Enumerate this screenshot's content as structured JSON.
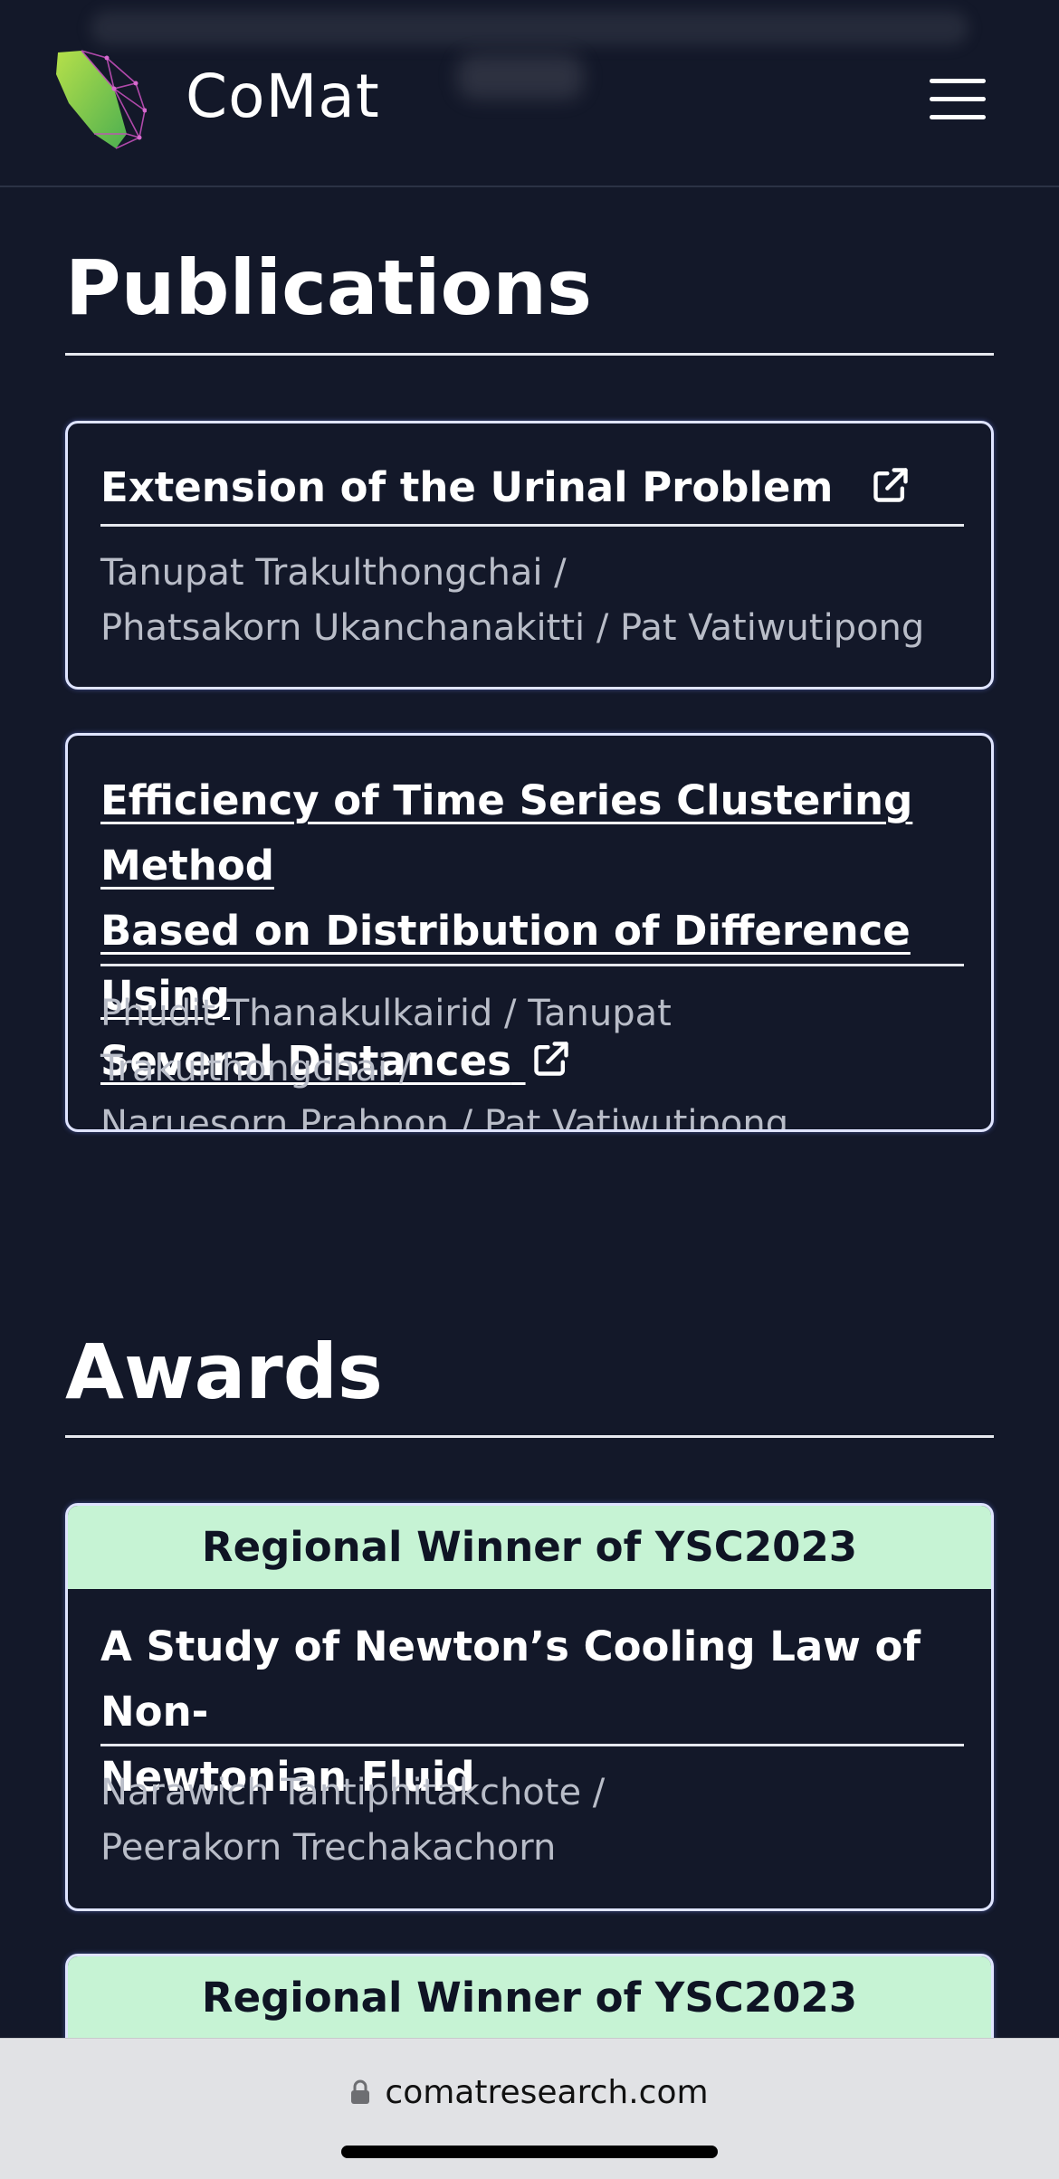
{
  "header": {
    "brand": "CoMat",
    "logo_icon": "leaf-network-logo",
    "menu_icon": "hamburger-menu-icon"
  },
  "publications": {
    "title": "Publications",
    "items": [
      {
        "title": "Extension of the Urinal Problem",
        "authors_line1": "Tanupat Trakulthongchai /",
        "authors_line2": "Phatsakorn Ukanchanakitti / Pat Vatiwutipong",
        "icon": "external-link-icon"
      },
      {
        "title_line1": "Efficiency of Time Series Clustering Method",
        "title_line2": "Based on Distribution of Difference Using",
        "title_line3": "Several Distances",
        "authors_line1": "Phudit Thanakulkairid / Tanupat Trakulthongchai /",
        "authors_line2": "Naruesorn Prabpon / Pat Vatiwutipong",
        "icon": "external-link-icon"
      }
    ]
  },
  "awards": {
    "title": "Awards",
    "items": [
      {
        "badge": "Regional Winner of YSC2023",
        "title_line1": "A Study of Newton’s Cooling Law of Non-",
        "title_line2": "Newtonian Fluid",
        "authors_line1": "Narawich Tantiphitakchote /",
        "authors_line2": "Peerakorn Trechakachorn"
      },
      {
        "badge": "Regional Winner of YSC2023"
      }
    ]
  },
  "browser": {
    "url": "comatresearch.com",
    "lock_icon": "lock-icon"
  },
  "colors": {
    "background": "#131829",
    "award_banner": "#c6f3d4",
    "card_border": "#dfe4ff",
    "author_text": "#b9bdc8"
  }
}
